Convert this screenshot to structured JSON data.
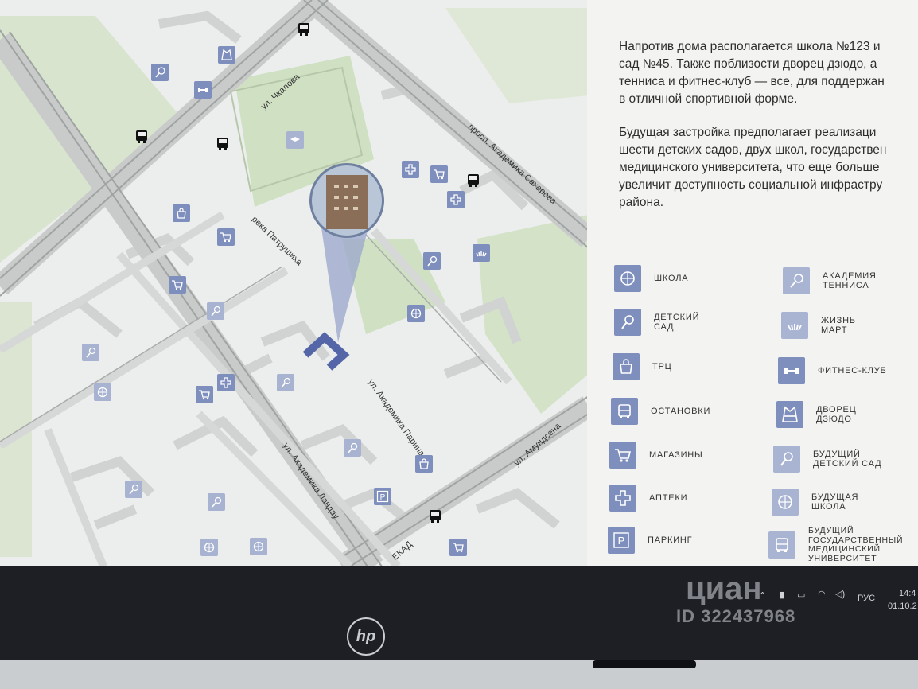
{
  "description": {
    "paragraph1": [
      "Напротив дома располагается школа №123 и",
      "сад №45. Также поблизости дворец дзюдо, а",
      "тенниса и фитнес-клуб — все, для поддержан",
      "в отличной спортивной форме."
    ],
    "paragraph2": [
      "Будущая застройка предполагает реализаци",
      "шести детских садов, двух школ, государствен",
      "медицинского университета, что еще больше",
      "увеличит доступность социальной инфрастру",
      "района."
    ]
  },
  "legend": [
    {
      "icon": "globe-icon",
      "label": [
        "ШКОЛА"
      ]
    },
    {
      "icon": "rattle-icon",
      "label": [
        "ДЕТСКИЙ",
        "САД"
      ]
    },
    {
      "icon": "bag-icon",
      "label": [
        "ТРЦ"
      ]
    },
    {
      "icon": "bus-icon",
      "label": [
        "ОСТАНОВКИ"
      ]
    },
    {
      "icon": "cart-icon",
      "label": [
        "МАГАЗИНЫ"
      ]
    },
    {
      "icon": "cross-icon",
      "label": [
        "АПТЕКИ"
      ]
    },
    {
      "icon": "parking-icon",
      "label": [
        "ПАРКИНГ"
      ]
    },
    {
      "icon": "tennis-icon",
      "label": [
        "АКАДЕМИЯ",
        "ТЕННИСА"
      ]
    },
    {
      "icon": "burst-icon",
      "label": [
        "ЖИЗНЬ",
        "МАРТ"
      ]
    },
    {
      "icon": "dumbbell-icon",
      "label": [
        "ФИТНЕС-КЛУБ"
      ]
    },
    {
      "icon": "kimono-icon",
      "label": [
        "ДВОРЕЦ",
        "ДЗЮДО"
      ]
    },
    {
      "icon": "rattle-icon",
      "label": [
        "БУДУЩИЙ",
        "ДЕТСКИЙ САД"
      ]
    },
    {
      "icon": "globe-icon",
      "label": [
        "БУДУЩАЯ",
        "ШКОЛА"
      ]
    },
    {
      "icon": "bus-icon",
      "label": [
        "БУДУЩИЙ",
        "ГОСУДАРСТВЕННЫЙ",
        "МЕДИЦИНСКИЙ",
        "УНИВЕРСИТЕТ"
      ]
    }
  ],
  "streets": {
    "chkalova": "ул. Чкалова",
    "sakharova": "просп. Академика Сахарова",
    "patrushikha": "река Патрушиха",
    "parina": "ул. Академика Парина",
    "landau": "ул. Академика Ландау",
    "amundsena": "ул. Амундсена",
    "ekad": "ЕКАД"
  },
  "parking_letter": "P",
  "taskbar": {
    "lang": "РУС",
    "time": "14:4",
    "date": "01.10.2"
  },
  "brand": "hp",
  "watermark": {
    "name": "циан",
    "id": "ID 322437968"
  },
  "colors": {
    "accent": "#7f8fbd",
    "green": "#cfe0c3",
    "road": "#d8dad8"
  }
}
